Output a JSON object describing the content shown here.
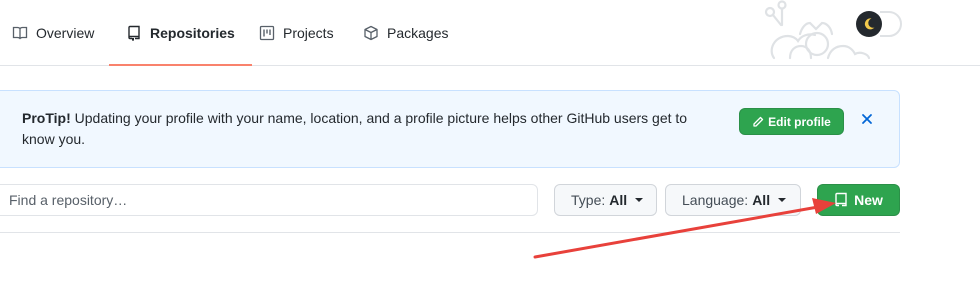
{
  "tabs": [
    {
      "label": "Overview",
      "icon": "book-icon",
      "active": false
    },
    {
      "label": "Repositories",
      "icon": "repo-icon",
      "active": true
    },
    {
      "label": "Projects",
      "icon": "project-icon",
      "active": false
    },
    {
      "label": "Packages",
      "icon": "package-icon",
      "active": false
    }
  ],
  "protip": {
    "title": "ProTip!",
    "message": "Updating your profile with your name, location, and a profile picture helps other GitHub users get to know you.",
    "edit_label": "Edit profile"
  },
  "filters": {
    "search_placeholder": "Find a repository…",
    "type_label": "Type:",
    "type_value": "All",
    "language_label": "Language:",
    "language_value": "All",
    "new_label": "New"
  },
  "colors": {
    "accent_green": "#2ea44f",
    "active_tab_underline": "#f9826c",
    "annotation_arrow": "#e8413b"
  }
}
